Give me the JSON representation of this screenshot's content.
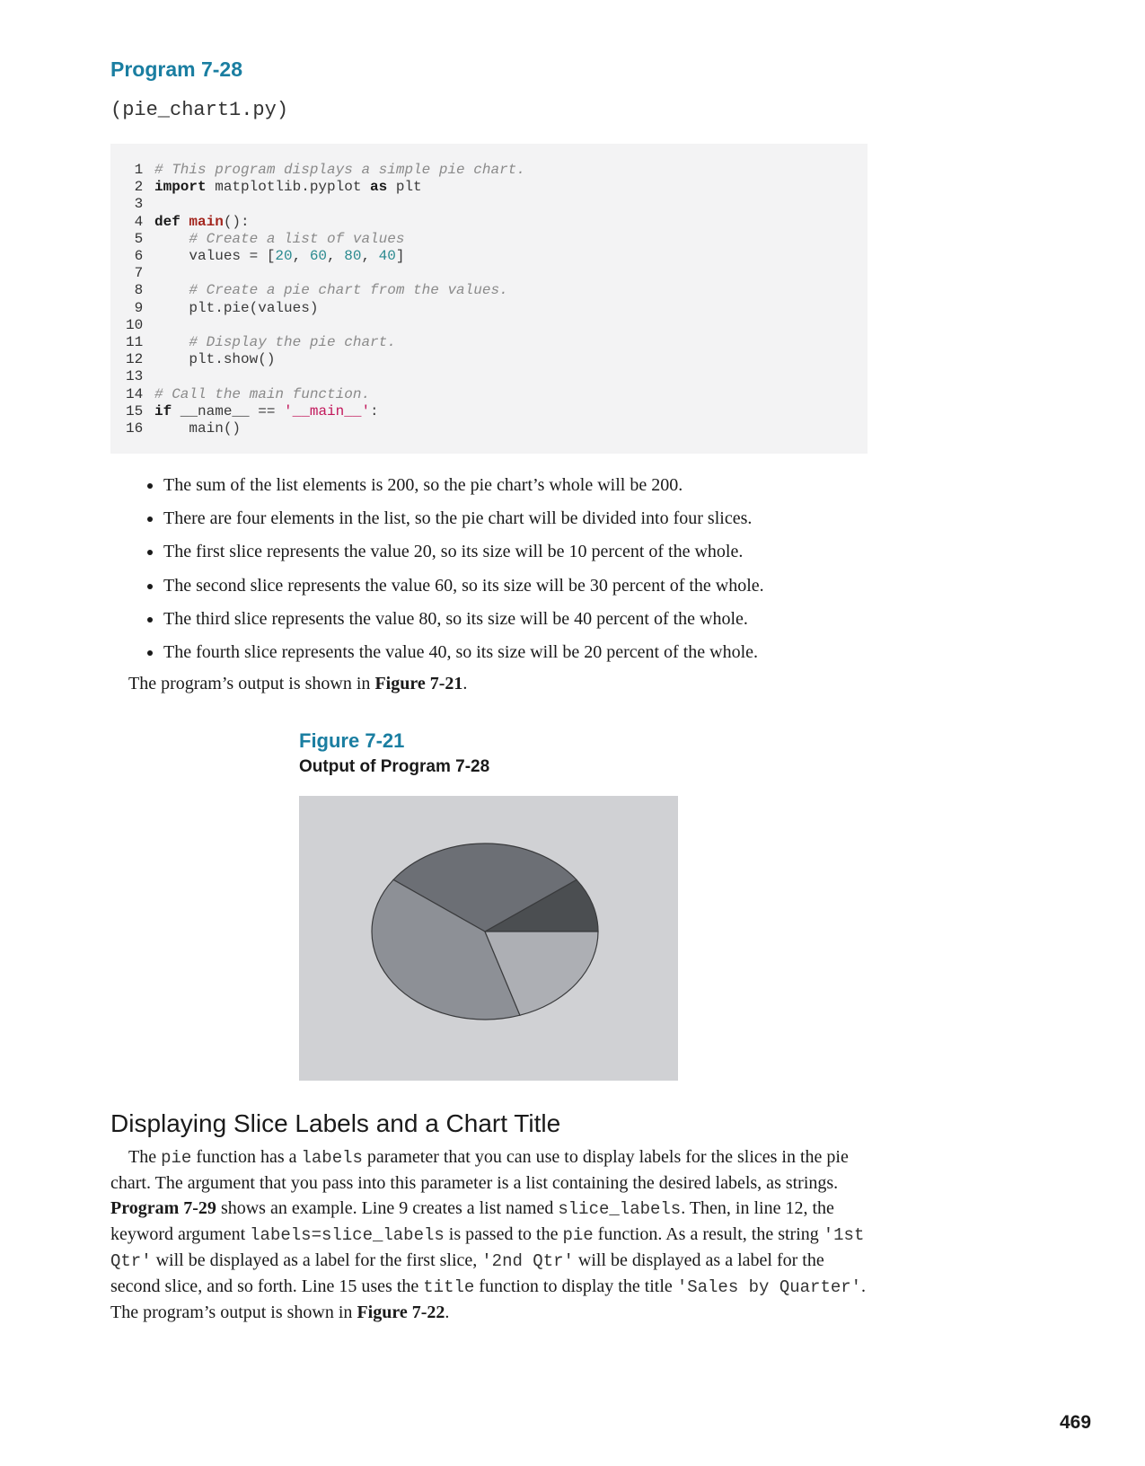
{
  "program": {
    "title": "Program 7-28",
    "file": "(pie_chart1.py)"
  },
  "code_lines": [
    "# This program displays a simple pie chart.",
    "import matplotlib.pyplot as plt",
    "",
    "def main():",
    "    # Create a list of values",
    "    values = [20, 60, 80, 40]",
    "",
    "    # Create a pie chart from the values.",
    "    plt.pie(values)",
    "",
    "    # Display the pie chart.",
    "    plt.show()",
    "",
    "# Call the main function.",
    "if __name__ == '__main__':",
    "    main()"
  ],
  "bullets": [
    "The sum of the list elements is 200, so the pie chart’s whole will be 200.",
    "There are four elements in the list, so the pie chart will be divided into four slices.",
    "The first slice represents the value 20, so its size will be 10 percent of the whole.",
    "The second slice represents the value 60, so its size will be 30 percent of the whole.",
    "The third slice represents the value 80, so its size will be 40 percent of the whole.",
    "The fourth slice represents the value 40, so its size will be 20 percent of the whole."
  ],
  "para1": {
    "text": "The program’s output is shown in ",
    "ref": "Figure 7-21",
    "end": "."
  },
  "figure": {
    "label": "Figure 7-21",
    "caption": "Output of Program 7-28"
  },
  "chart_data": {
    "type": "pie",
    "values": [
      20,
      60,
      80,
      40
    ],
    "colors": [
      "#4b4e51",
      "#6c6f75",
      "#8d9096",
      "#adafb4"
    ],
    "background": "#d0d1d4",
    "start_angle_deg": 0,
    "counterclock": true
  },
  "section": {
    "heading": "Displaying Slice Labels and a Chart Title",
    "t1": "The ",
    "c1": "pie",
    "t2": " function has a ",
    "c2": "labels",
    "t3": " parameter that you can use to display labels for the slices in the pie chart. The argument that you pass into this parameter is a list containing the desired labels, as strings. ",
    "b1": "Program 7-29",
    "t4": " shows an example. Line 9 creates a list named ",
    "c3": "slice_labels",
    "t5": ". Then, in line 12, the keyword argument ",
    "c4": "labels=slice_labels",
    "t6": " is passed to the ",
    "c5": "pie",
    "t7": " function. As a result, the string ",
    "c6": "'1st Qtr'",
    "t8": " will be displayed as a label for the first slice, ",
    "c7": "'2nd Qtr'",
    "t9": " will be displayed as a label for the second slice, and so forth. Line 15 uses the ",
    "c8": "title",
    "t10": " function to display the title ",
    "c9": "'Sales by Quarter'",
    "t11": ". The program’s output is shown in ",
    "b2": "Figure 7-22",
    "t12": "."
  },
  "page_number": "469"
}
